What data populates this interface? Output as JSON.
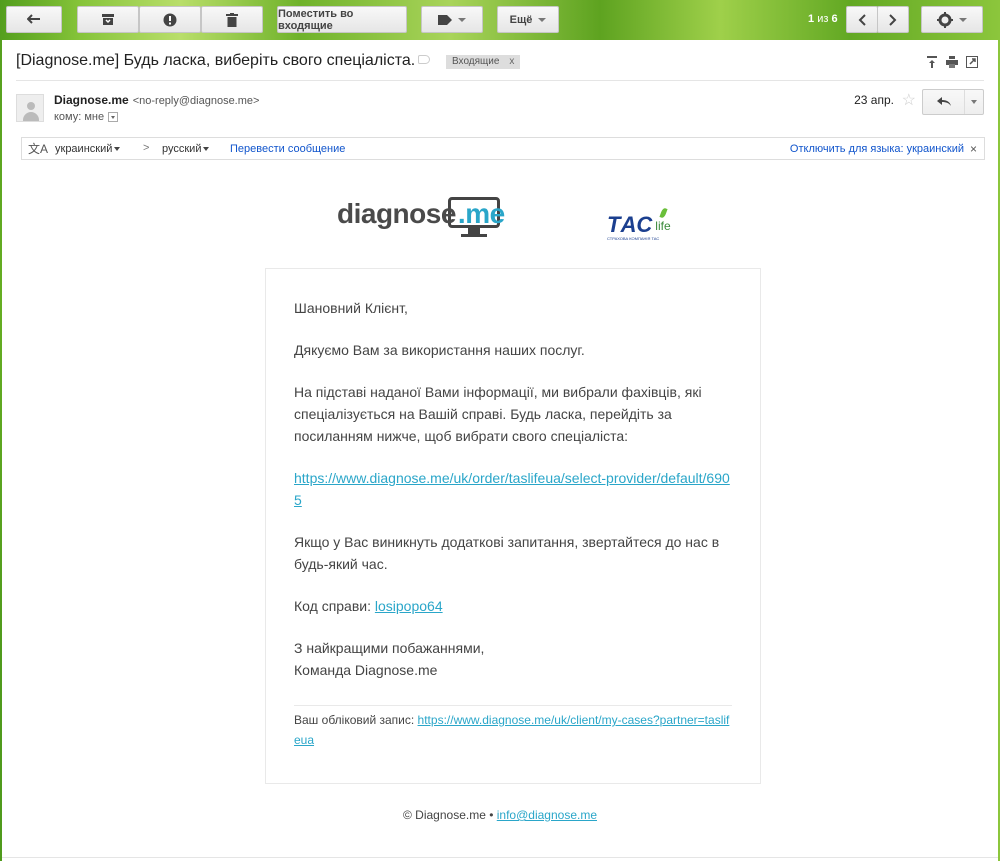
{
  "toolbar": {
    "back_icon": "arrow-back-icon",
    "archive_icon": "archive-icon",
    "spam_icon": "report-spam-icon",
    "delete_icon": "trash-icon",
    "move_inbox_label": "Поместить во входящие",
    "labels_icon": "label-tag-icon",
    "more_label": "Ещё",
    "counter_range": "1",
    "counter_of": "из",
    "counter_total": "6",
    "settings_icon": "gear-icon"
  },
  "message": {
    "subject": "[Diagnose.me] Будь ласка, виберіть свого спеціаліста.",
    "label": "Входящие",
    "label_remove": "x",
    "sender_name": "Diagnose.me",
    "sender_email": "<no-reply@diagnose.me>",
    "to_line": "кому: мне",
    "date": "23 апр.",
    "star": "☆"
  },
  "translate": {
    "from_lang": "украинский",
    "arrow": ">",
    "to_lang": "русский",
    "translate_link": "Перевести сообщение",
    "disable_link": "Отключить для языка: украинский",
    "close": "×"
  },
  "logos": {
    "diagnose_text": "diagnose",
    "diagnose_me": ".me",
    "tas_text": "ТАС",
    "tas_life": "life",
    "tas_sub": "СТРАХОВА КОМПАНІЯ ТАС"
  },
  "body": {
    "greeting": "Шановний Клієнт,",
    "thanks": "Дякуємо Вам за використання наших послуг.",
    "info": "На підставі наданої Вами інформації, ми вибрали фахівців, які спеціалізується на Вашій справі. Будь ласка, перейдіть за посиланням нижче, щоб вибрати свого спеціаліста:",
    "link": "https://www.diagnose.me/uk/order/taslifeua/select-provider/default/6905",
    "questions": "Якщо у Вас виникнуть додаткові запитання, звертайтеся до нас в будь-який час.",
    "case_label": "Код справи: ",
    "case_code": "losipopo64",
    "regards": "З найкращими побажаннями,",
    "team": "Команда Diagnose.me",
    "account_label": "Ваш обліковий запис: ",
    "account_link": "https://www.diagnose.me/uk/client/my-cases?partner=taslifeua"
  },
  "footer": {
    "copyright": "© Diagnose.me • ",
    "email": "info@diagnose.me"
  }
}
